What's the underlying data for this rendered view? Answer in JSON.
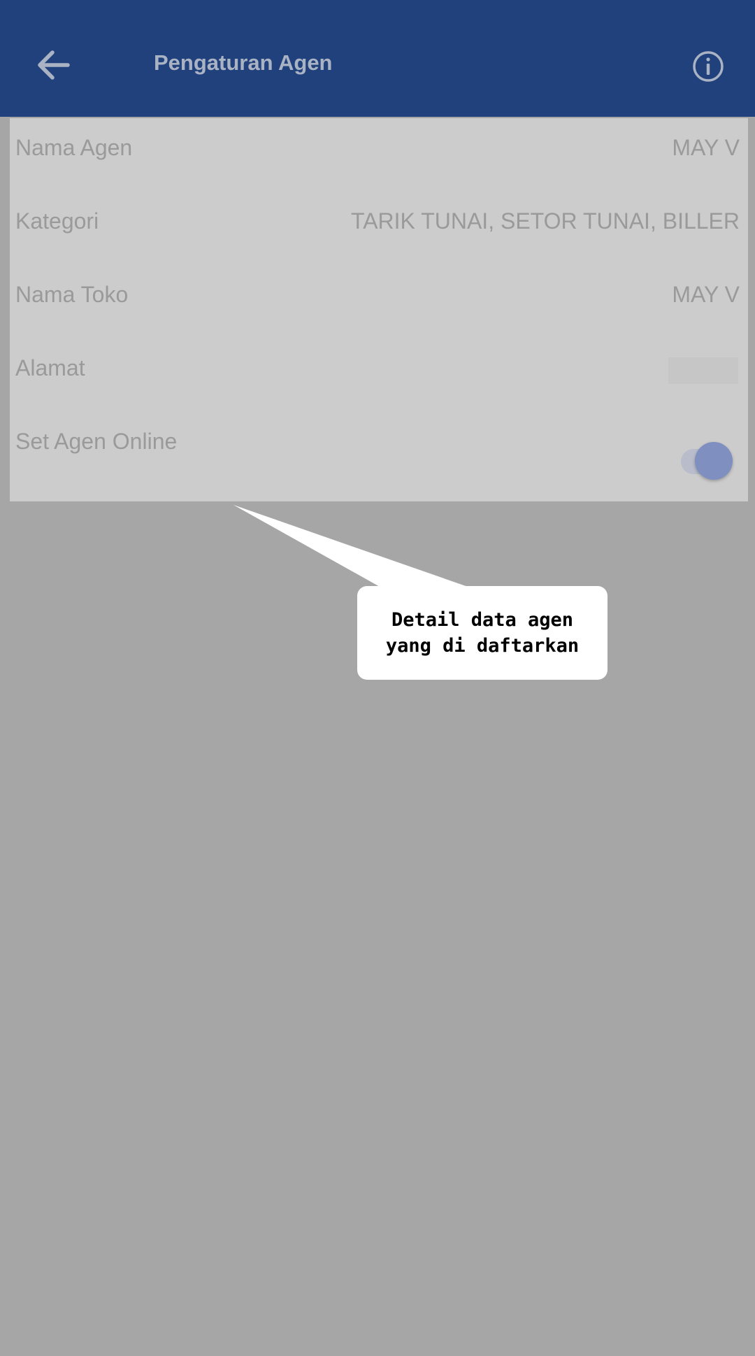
{
  "header": {
    "title": "Pengaturan Agen",
    "back_icon": "arrow-left-icon",
    "info_icon": "info-icon"
  },
  "agent_settings": {
    "rows": [
      {
        "label": "Nama Agen",
        "value": "MAY V"
      },
      {
        "label": "Kategori",
        "value": "TARIK TUNAI, SETOR TUNAI, BILLER"
      },
      {
        "label": "Nama Toko",
        "value": "MAY V"
      },
      {
        "label": "Alamat",
        "value": ""
      },
      {
        "label": "Set Agen Online",
        "toggle_on": true
      }
    ]
  },
  "callout": {
    "text": "Detail data agen yang di daftarkan"
  },
  "colors": {
    "appbar": "#21417d",
    "overlay": "#a6a6a6",
    "panel": "#cccccc",
    "toggle_thumb": "#7e8fc0"
  }
}
